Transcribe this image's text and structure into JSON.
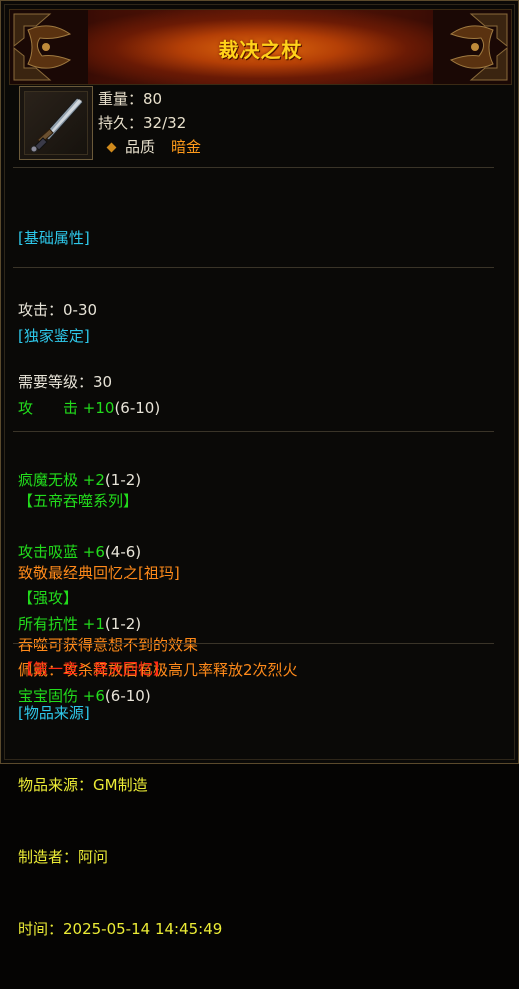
{
  "item": {
    "title": "裁决之杖",
    "icon": "sword-icon",
    "weight_label": "重量：",
    "weight_value": "80",
    "durability_label": "持久：",
    "durability_value": "32/32",
    "quality_label": "品质",
    "quality_value": "暗金"
  },
  "basic": {
    "header": "[基础属性]",
    "attack": "攻击：0-30",
    "level": "需要等级：30"
  },
  "unique": {
    "header": "[独家鉴定]",
    "rows": [
      {
        "name": "攻　　击",
        "bonus": "+10",
        "range": "(6-10)"
      },
      {
        "name": "疯魔无极",
        "bonus": "+2",
        "range": "(1-2)"
      },
      {
        "name": "攻击吸蓝",
        "bonus": "+6",
        "range": "(4-6)"
      },
      {
        "name": "所有抗性",
        "bonus": "+1",
        "range": "(1-2)"
      },
      {
        "name": "宝宝固伤",
        "bonus": "+6",
        "range": "(6-10)"
      }
    ]
  },
  "series": {
    "header": "【五帝吞噬系列】",
    "line1": "致敬最经典回忆之[祖玛]",
    "line2": "吞噬可获得意想不到的效果"
  },
  "strong": {
    "header": "【强攻】",
    "line": "佩戴：攻杀释放后有极高几率释放2次烈火"
  },
  "chapter": {
    "label": "【第一章：昊天回忆】"
  },
  "source": {
    "header": "[物品来源]",
    "origin": "物品来源：GM制造",
    "maker": "制造者：阿问",
    "time": "时间：2025-05-14 14:45:49"
  },
  "colors": {
    "title": "#ffd21a",
    "section_header": "#2ec8ea",
    "attribute_green": "#22dc1c",
    "quality": "#ff9a1a",
    "series": "#ff8a1a",
    "chapter": "#ff2a14",
    "source_text": "#ecec36"
  }
}
